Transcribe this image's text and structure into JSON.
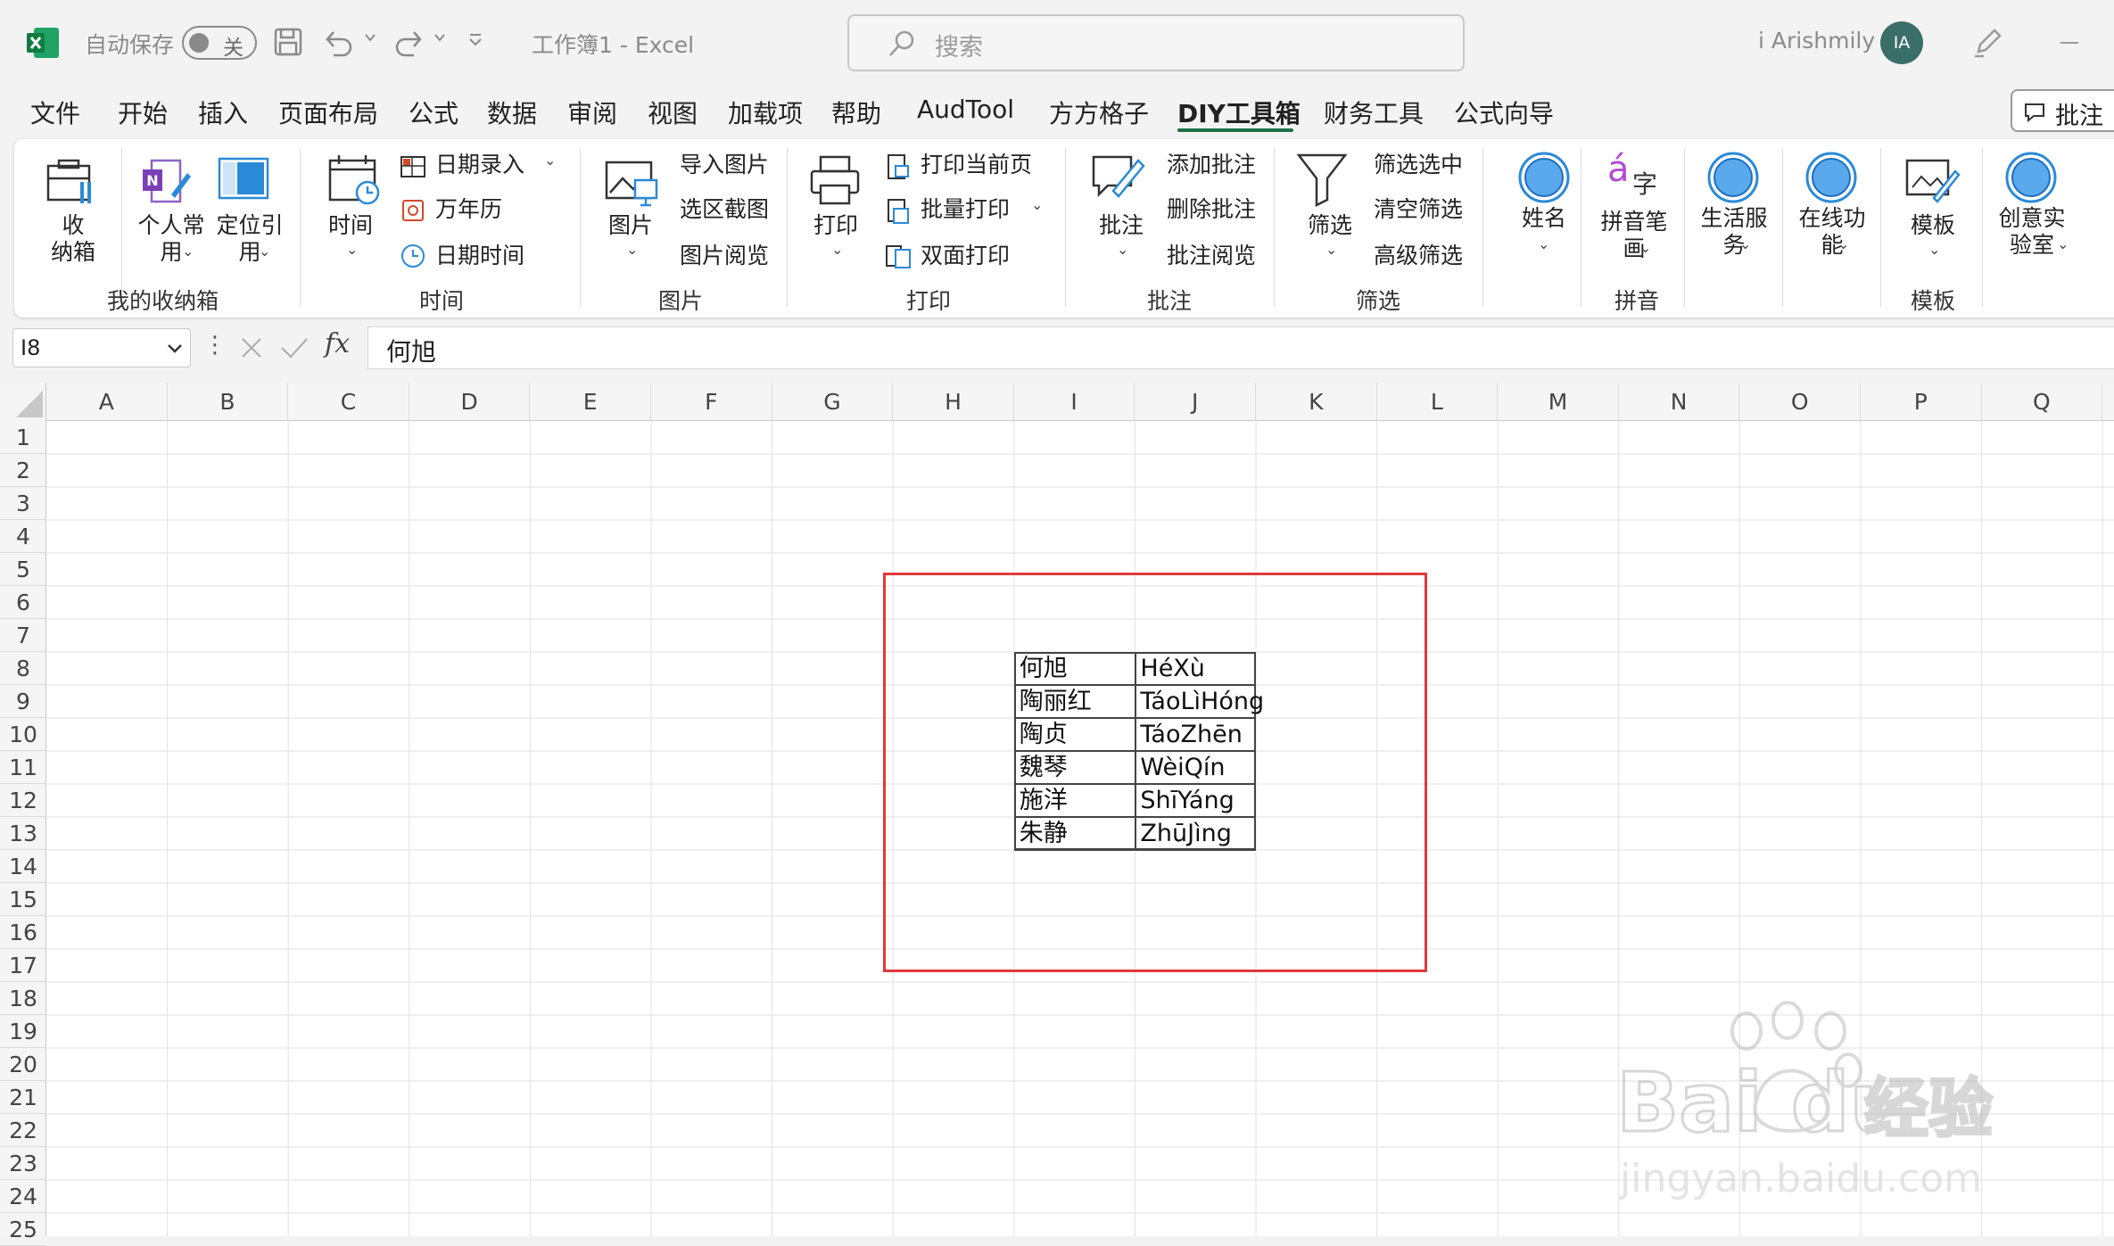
{
  "titlebar": {
    "autosave_label": "自动保存",
    "autosave_state": "关",
    "doc_title": "工作簿1  -  Excel",
    "search_label": "搜索",
    "user_name": "i Arishmily",
    "avatar_initials": "IA"
  },
  "menu": {
    "tabs": [
      "文件",
      "开始",
      "插入",
      "页面布局",
      "公式",
      "数据",
      "审阅",
      "视图",
      "加载项",
      "帮助",
      "AudTool",
      "方方格子",
      "DIY工具箱",
      "财务工具",
      "公式向导"
    ],
    "active_tab": "DIY工具箱",
    "comments_button": "批注"
  },
  "ribbon": {
    "storage": {
      "btn1": "收\n纳箱",
      "btn2": "个人常\n用",
      "btn3": "定位引\n用",
      "group": "我的收纳箱"
    },
    "time": {
      "btn_time": "时间",
      "item1": "日期录入",
      "item2": "万年历",
      "item3": "日期时间",
      "group": "时间"
    },
    "picture": {
      "btn_picture": "图片",
      "item1": "导入图片",
      "item2": "选区截图",
      "item3": "图片阅览",
      "group": "图片"
    },
    "print": {
      "btn_print": "打印",
      "item1": "打印当前页",
      "item2": "批量打印",
      "item3": "双面打印",
      "group": "打印"
    },
    "comment": {
      "btn_comment": "批注",
      "item1": "添加批注",
      "item2": "删除批注",
      "item3": "批注阅览",
      "group": "批注"
    },
    "filter": {
      "btn_filter": "筛选",
      "item1": "筛选选中",
      "item2": "清空筛选",
      "item3": "高级筛选",
      "group": "筛选"
    },
    "name": {
      "btn_name": "姓名"
    },
    "pinyin": {
      "btn_pinyin": "拼音笔\n画",
      "group": "拼音",
      "icon_a": "á",
      "icon_zi": "字"
    },
    "life": {
      "btn": "生活服\n务"
    },
    "online": {
      "btn": "在线功\n能"
    },
    "template": {
      "btn": "模板",
      "group": "模板"
    },
    "creative": {
      "btn": "创意实\n验室"
    }
  },
  "formula_bar": {
    "cell_ref": "I8",
    "value": "何旭"
  },
  "grid": {
    "columns": [
      "A",
      "B",
      "C",
      "D",
      "E",
      "F",
      "G",
      "H",
      "I",
      "J",
      "K",
      "L",
      "M",
      "N",
      "O",
      "P",
      "Q"
    ],
    "rows": [
      "1",
      "2",
      "3",
      "4",
      "5",
      "6",
      "7",
      "8",
      "9",
      "10",
      "11",
      "12",
      "13",
      "14",
      "15",
      "16",
      "17",
      "18",
      "19",
      "20",
      "21",
      "22",
      "23",
      "24",
      "25"
    ],
    "data": [
      {
        "name": "何旭",
        "pinyin": "HéXù"
      },
      {
        "name": "陶丽红",
        "pinyin": "TáoLìHóng"
      },
      {
        "name": "陶贞",
        "pinyin": "TáoZhēn"
      },
      {
        "name": "魏琴",
        "pinyin": "WèiQín"
      },
      {
        "name": "施洋",
        "pinyin": "ShīYáng"
      },
      {
        "name": "朱静",
        "pinyin": "ZhūJìng"
      }
    ]
  },
  "watermark": {
    "brand": "Bai du",
    "brand_cn": "经验",
    "url": "jingyan.baidu.com"
  },
  "colors": {
    "excel_green": "#1e7145",
    "highlight_red": "#e03a3a",
    "ribbon_blue": "#2a8ad8"
  }
}
